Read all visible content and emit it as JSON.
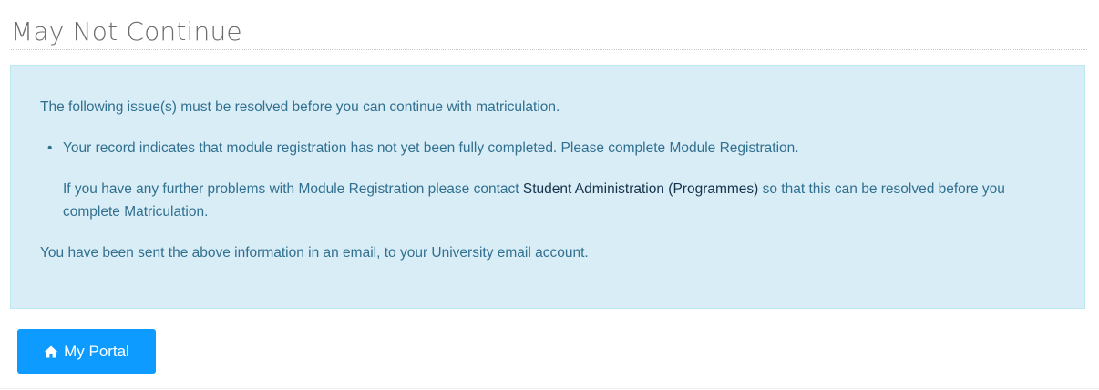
{
  "header": {
    "title": "May Not Continue"
  },
  "alert": {
    "intro": "The following issue(s) must be resolved before you can continue with matriculation.",
    "issues": [
      {
        "text": "Your record indicates that module registration has not yet been fully completed. Please complete Module Registration.",
        "followup_before": "If you have any further problems with Module Registration please contact ",
        "link_text": "Student Administration (Programmes)",
        "followup_after": " so that this can be resolved before you complete Matriculation."
      }
    ],
    "footer": "You have been sent the above information in an email, to your University email account."
  },
  "actions": {
    "portal_label": "My Portal",
    "portal_icon": "home-icon"
  },
  "colors": {
    "alert_background": "#d9edf7",
    "alert_text": "#31708f",
    "button_background": "#0d9bff"
  }
}
